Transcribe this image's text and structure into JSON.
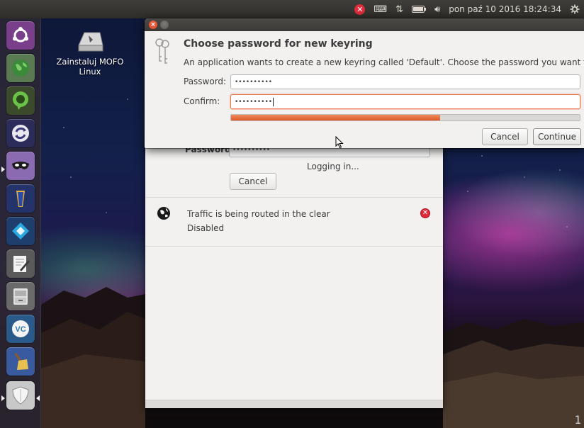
{
  "top_panel": {
    "tray_icons": [
      "vpn-error-icon",
      "keyboard-icon",
      "network-icon",
      "battery-icon",
      "volume-icon"
    ],
    "clock": "pon paź 10 2016 18:24:34",
    "session_icon": "gear-icon",
    "colors": {
      "error_red": "#e02b3b"
    }
  },
  "launcher": {
    "items": [
      {
        "name": "dash-home",
        "icon": "ubuntu-logo-icon",
        "color": "#7a4a8f"
      },
      {
        "name": "browser",
        "icon": "globe-icon",
        "color": "#3a7a4a"
      },
      {
        "name": "hangouts",
        "icon": "chat-bubble-icon",
        "color": "#3a5a2a"
      },
      {
        "name": "sync",
        "icon": "sync-icon",
        "color": "#2a3a6a"
      },
      {
        "name": "vpn-app",
        "icon": "mask-icon",
        "color": "#8a6aaa"
      },
      {
        "name": "totem-app",
        "icon": "totem-icon",
        "color": "#2a4a8a"
      },
      {
        "name": "kodi",
        "icon": "kodi-icon",
        "color": "#2a5a9a"
      },
      {
        "name": "text-editor",
        "icon": "pencil-icon",
        "color": "#6a6a6a"
      },
      {
        "name": "file-manager",
        "icon": "cabinet-icon",
        "color": "#7a7a7a"
      },
      {
        "name": "viscosity",
        "icon": "vc-icon",
        "color": "#2a6a9a"
      },
      {
        "name": "bleachbit",
        "icon": "broom-icon",
        "color": "#3a5a9a"
      },
      {
        "name": "mofo-installer",
        "icon": "shield-icon",
        "color": "#9a9a9a"
      }
    ]
  },
  "desktop": {
    "icon_label_line1": "Zainstaluj MOFO",
    "icon_label_line2": "Linux"
  },
  "background_window": {
    "password_label": "Password:",
    "password_value": "••••••••••",
    "logging_text": "Logging in...",
    "cancel_label": "Cancel",
    "traffic_title": "Traffic is being routed in the clear",
    "traffic_status": "Disabled"
  },
  "dialog": {
    "title": "Choose password for new keyring",
    "description": "An application wants to create a new keyring called 'Default'. Choose the password you want to use for it.",
    "password_label": "Password:",
    "password_value": "••••••••••",
    "confirm_label": "Confirm:",
    "confirm_value": "••••••••••",
    "strength_fraction": 0.6,
    "cancel_label": "Cancel",
    "continue_label": "Continue",
    "accent_color": "#dd5a2b"
  },
  "workspace_number": "1"
}
